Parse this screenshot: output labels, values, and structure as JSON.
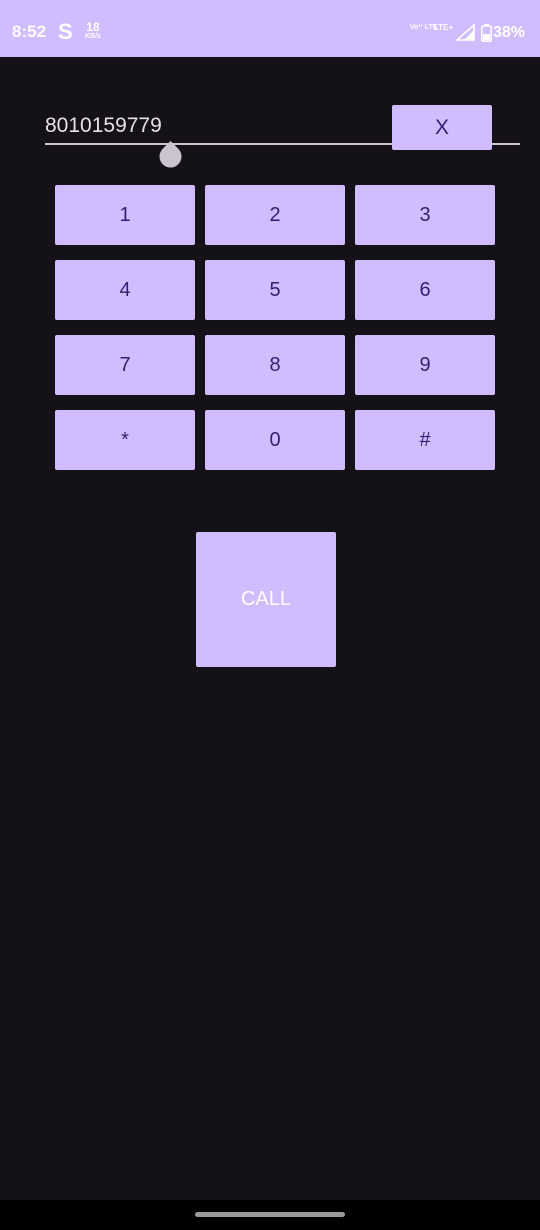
{
  "status_bar": {
    "time": "8:52",
    "app_icon": "S",
    "speed_value": "18",
    "speed_unit": "KB/s",
    "volte": "Vo¹⁾ LTE",
    "network": "LTE+",
    "battery_percent": "38%"
  },
  "dialer": {
    "number": "8010159779",
    "clear_label": "X",
    "keys": [
      "1",
      "2",
      "3",
      "4",
      "5",
      "6",
      "7",
      "8",
      "9",
      "*",
      "0",
      "#"
    ],
    "call_label": "CALL"
  },
  "colors": {
    "accent": "#d0bcff",
    "background": "#141218",
    "button_text": "#381e72"
  }
}
